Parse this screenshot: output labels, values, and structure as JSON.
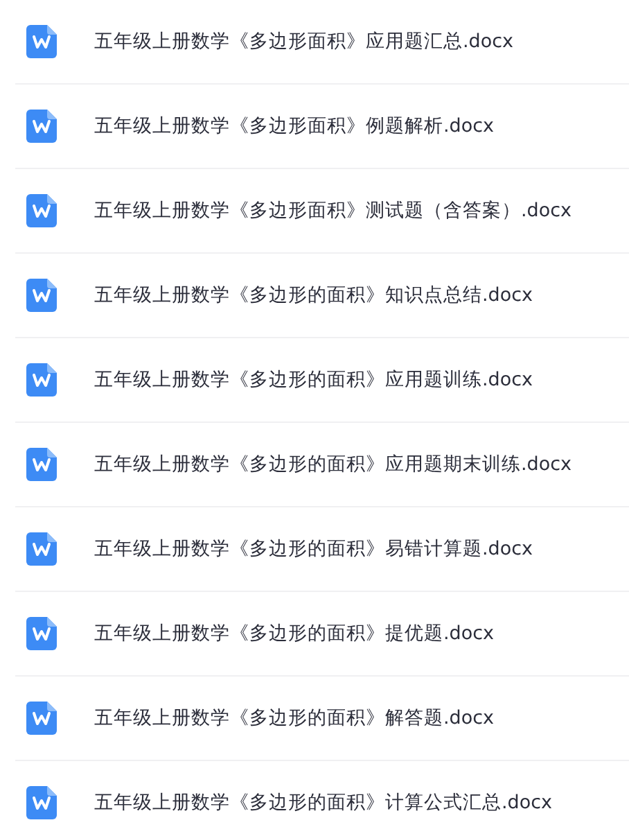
{
  "files": [
    {
      "name": "五年级上册数学《多边形面积》应用题汇总.docx"
    },
    {
      "name": "五年级上册数学《多边形面积》例题解析.docx"
    },
    {
      "name": "五年级上册数学《多边形面积》测试题（含答案）.docx"
    },
    {
      "name": "五年级上册数学《多边形的面积》知识点总结.docx"
    },
    {
      "name": "五年级上册数学《多边形的面积》应用题训练.docx"
    },
    {
      "name": "五年级上册数学《多边形的面积》应用题期末训练.docx"
    },
    {
      "name": "五年级上册数学《多边形的面积》易错计算题.docx"
    },
    {
      "name": "五年级上册数学《多边形的面积》提优题.docx"
    },
    {
      "name": "五年级上册数学《多边形的面积》解答题.docx"
    },
    {
      "name": "五年级上册数学《多边形的面积》计算公式汇总.docx"
    }
  ]
}
